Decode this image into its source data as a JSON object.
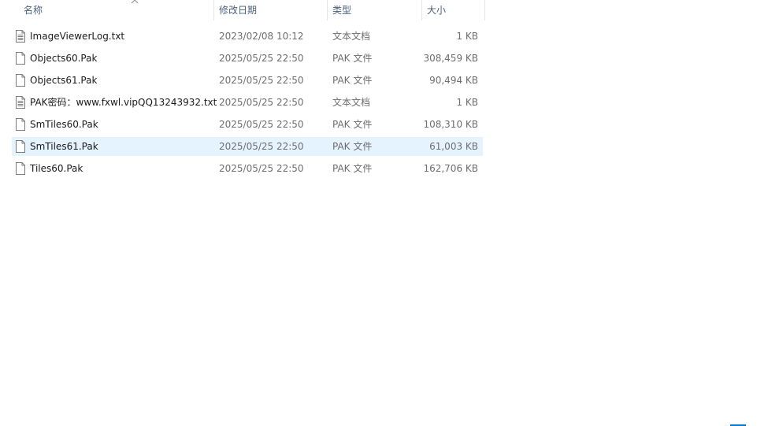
{
  "columns": {
    "name": "名称",
    "date": "修改日期",
    "type": "类型",
    "size": "大小"
  },
  "sort": {
    "column": "name",
    "icon": "sort-chevron-up-icon"
  },
  "accent_color": "#0078d7",
  "selection_color": "#e5f3ff",
  "files": [
    {
      "name": "ImageViewerLog.txt",
      "date": "2023/02/08 10:12",
      "type": "文本文档",
      "size": "1 KB",
      "icon": "text-file-icon"
    },
    {
      "name": "Objects60.Pak",
      "date": "2025/05/25 22:50",
      "type": "PAK 文件",
      "size": "308,459 KB",
      "icon": "blank-file-icon"
    },
    {
      "name": "Objects61.Pak",
      "date": "2025/05/25 22:50",
      "type": "PAK 文件",
      "size": "90,494 KB",
      "icon": "blank-file-icon"
    },
    {
      "name": "PAK密码：www.fxwl.vipQQ13243932.txt",
      "date": "2025/05/25 22:50",
      "type": "文本文档",
      "size": "1 KB",
      "icon": "text-file-icon"
    },
    {
      "name": "SmTiles60.Pak",
      "date": "2025/05/25 22:50",
      "type": "PAK 文件",
      "size": "108,310 KB",
      "icon": "blank-file-icon"
    },
    {
      "name": "SmTiles61.Pak",
      "date": "2025/05/25 22:50",
      "type": "PAK 文件",
      "size": "61,003 KB",
      "icon": "blank-file-icon",
      "selected": true
    },
    {
      "name": "Tiles60.Pak",
      "date": "2025/05/25 22:50",
      "type": "PAK 文件",
      "size": "162,706 KB",
      "icon": "blank-file-icon"
    }
  ]
}
